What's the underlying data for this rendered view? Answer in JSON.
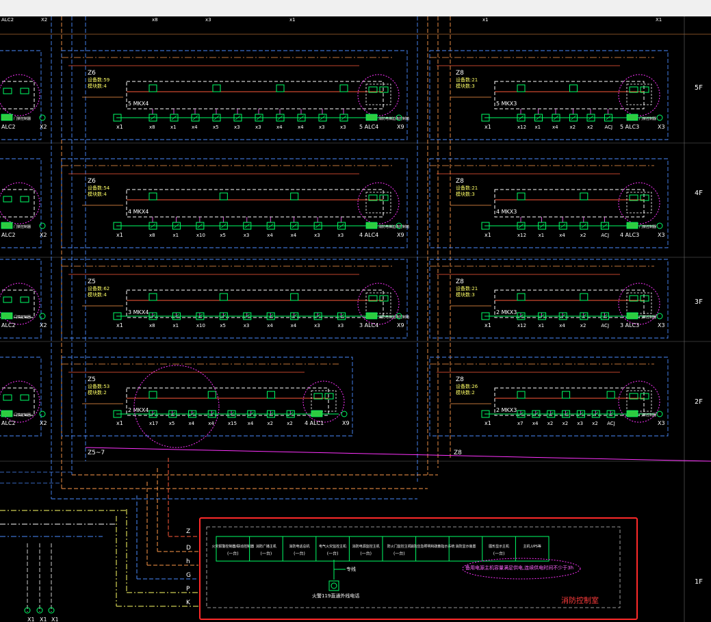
{
  "app": {
    "viewport": "CAD drawing viewport"
  },
  "floors": [
    {
      "label": "5F"
    },
    {
      "label": "4F"
    },
    {
      "label": "3F"
    },
    {
      "label": "2F"
    },
    {
      "label": "1F"
    }
  ],
  "panels": [
    {
      "id": "z6-5",
      "zone": "Z6",
      "info1": "设备数:59",
      "info2": "模块数:4",
      "module": "5 MKX4",
      "alarm": "5 ALC4",
      "left_label": "x1",
      "right_label": "X9",
      "devices": [
        "x8",
        "x1",
        "x4",
        "x5",
        "x3",
        "x3",
        "x4",
        "x4",
        "x3",
        "x3"
      ],
      "extra": "消防电梯迫降控制箱"
    },
    {
      "id": "z8-5",
      "zone": "Z8",
      "info1": "设备数:21",
      "info2": "模块数:3",
      "module": "5 MKX3",
      "alarm": "5 ALC3",
      "left_label": "x1",
      "right_label": "X3",
      "devices": [
        "x12",
        "x1",
        "x4",
        "x2",
        "x2",
        "ACJ"
      ],
      "extra": "门禁控制器"
    },
    {
      "id": "z6-4",
      "zone": "Z6",
      "info1": "设备数:54",
      "info2": "模块数:4",
      "module": "4 MKX4",
      "alarm": "4 ALC4",
      "left_label": "x1",
      "right_label": "X9",
      "devices": [
        "x8",
        "x1",
        "x10",
        "x5",
        "x3",
        "x4",
        "x4",
        "x3",
        "x3"
      ],
      "extra": "消防电梯迫降控制箱"
    },
    {
      "id": "z8-4",
      "zone": "Z8",
      "info1": "设备数:21",
      "info2": "模块数:3",
      "module": "4 MKX3",
      "alarm": "4 ALC3",
      "left_label": "x1",
      "right_label": "X3",
      "devices": [
        "x12",
        "x1",
        "x4",
        "x2",
        "ACJ"
      ],
      "extra": "门禁控制器"
    },
    {
      "id": "z5-3",
      "zone": "Z5",
      "info1": "设备数:62",
      "info2": "模块数:4",
      "module": "3 MKX4",
      "alarm": "3 ALC4",
      "left_label": "x1",
      "right_label": "X9",
      "devices": [
        "x8",
        "x1",
        "x10",
        "x5",
        "x3",
        "x4",
        "x4",
        "x3",
        "x3"
      ],
      "extra": "消防电梯迫降控制箱"
    },
    {
      "id": "z8-3",
      "zone": "Z8",
      "info1": "设备数:21",
      "info2": "模块数:3",
      "module": "2 MKX3",
      "alarm": "3 ALC3",
      "left_label": "x1",
      "right_label": "X3",
      "devices": [
        "x12",
        "x1",
        "x4",
        "x2",
        "ACJ"
      ],
      "extra": "门禁控制器"
    },
    {
      "id": "z5-2",
      "zone": "Z5",
      "info1": "设备数:53",
      "info2": "模块数:2",
      "module": "2 MKX4",
      "alarm": "4 ALC1",
      "left_label": "x1",
      "right_label": "X9",
      "devices": [
        "x17",
        "x5",
        "x4",
        "x4",
        "x15",
        "x4",
        "x2",
        "x2"
      ],
      "extra": ""
    },
    {
      "id": "z8-2",
      "zone": "Z8",
      "info1": "设备数:26",
      "info2": "模块数:2",
      "module": "2 MKX3",
      "alarm": "",
      "left_label": "x1",
      "right_label": "X3",
      "devices": [
        "x7",
        "x4",
        "x2",
        "x2",
        "x3",
        "x2",
        "ACJ"
      ],
      "extra": "门禁控制器"
    }
  ],
  "left_edge": {
    "alarms": [
      "ALC2",
      "ALC2",
      "ALC2",
      "ALC2"
    ],
    "right_labels": [
      "X2",
      "X2",
      "X2",
      "X2"
    ],
    "door_label": "门禁控制器"
  },
  "bus": {
    "left": "Z5~7",
    "right": "Z8"
  },
  "top_labels": [
    "ALC2",
    "X2",
    "x8",
    "x3",
    "x1",
    "x1",
    "X1"
  ],
  "trunk_labels": [
    "Z",
    "D",
    "h",
    "G",
    "P",
    "K"
  ],
  "bottom_labels": [
    "X1",
    "X1",
    "X1"
  ],
  "control_room": {
    "title": "消防控制室",
    "cells": [
      {
        "top": "火灾报警控制器/联动控制器",
        "bottom": "(一台)"
      },
      {
        "top": "消防广播主机",
        "bottom": "(一台)"
      },
      {
        "top": "消防电话总机",
        "bottom": "(一台)"
      },
      {
        "top": "电气火灾监控主机",
        "bottom": "(一台)"
      },
      {
        "top": "消防电源监控主机",
        "bottom": "(一台)"
      },
      {
        "top": "防火门监控主机",
        "bottom": "(一台)"
      },
      {
        "top": "消防应急照明和疏散指示系统",
        "bottom": ""
      },
      {
        "top": "消防显示装置",
        "bottom": ""
      },
      {
        "top": "图形显示主机",
        "bottom": "(一台)"
      },
      {
        "top": "主机,UPS等",
        "bottom": ""
      }
    ],
    "cloud_note": "备用电源主机容量满足供电,连续供电时间不少于3h",
    "pipe_label": "专线",
    "device_label": "火警119直通外线电话"
  }
}
